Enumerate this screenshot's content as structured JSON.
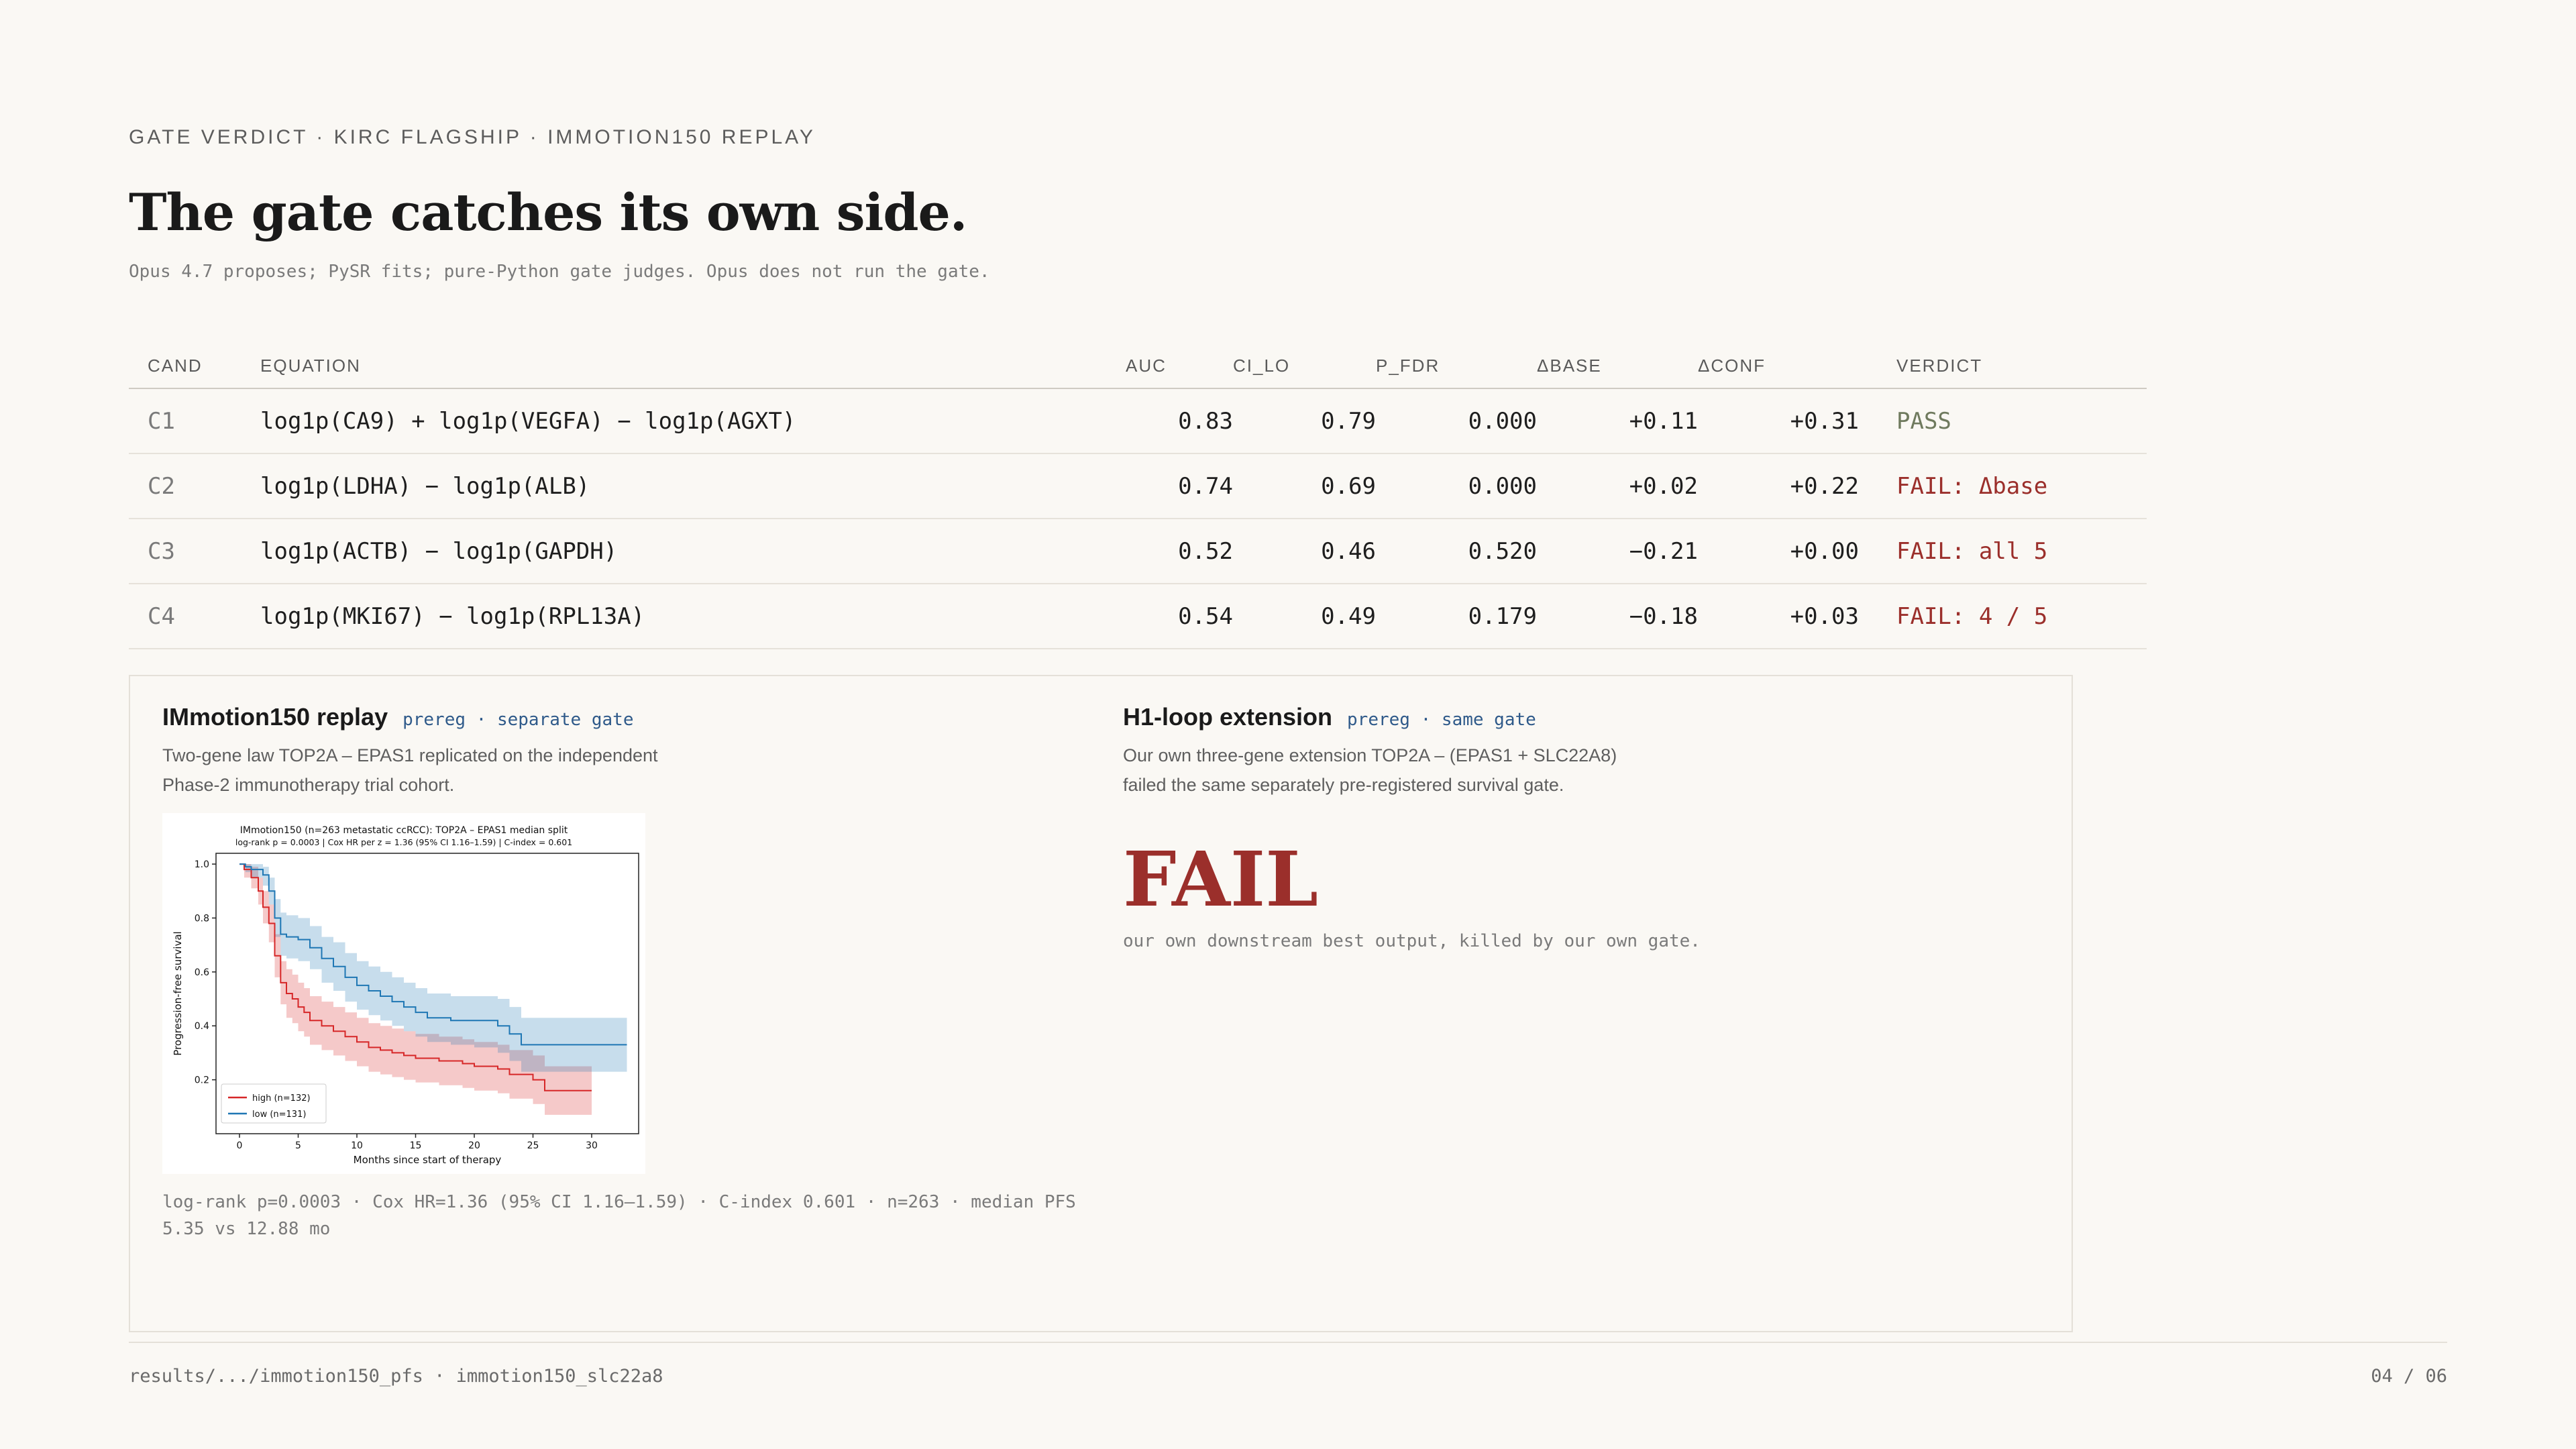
{
  "header": {
    "kicker": "GATE VERDICT · KIRC FLAGSHIP · IMMOTION150 REPLAY",
    "title": "The gate catches its own side.",
    "subtitle": "Opus 4.7 proposes; PySR fits; pure-Python gate judges. Opus does not run the gate."
  },
  "table": {
    "headers": [
      "CAND",
      "EQUATION",
      "AUC",
      "CI_LO",
      "P_FDR",
      "ΔBASE",
      "ΔCONF",
      "VERDICT"
    ],
    "rows": [
      {
        "cand": "C1",
        "equation": "log1p(CA9) + log1p(VEGFA) − log1p(AGXT)",
        "auc": "0.83",
        "ci_lo": "0.79",
        "p_fdr": "0.000",
        "dbase": "+0.11",
        "dconf": "+0.31",
        "verdict": "PASS",
        "status": "pass"
      },
      {
        "cand": "C2",
        "equation": "log1p(LDHA) − log1p(ALB)",
        "auc": "0.74",
        "ci_lo": "0.69",
        "p_fdr": "0.000",
        "dbase": "+0.02",
        "dconf": "+0.22",
        "verdict": "FAIL: Δbase",
        "status": "fail"
      },
      {
        "cand": "C3",
        "equation": "log1p(ACTB) − log1p(GAPDH)",
        "auc": "0.52",
        "ci_lo": "0.46",
        "p_fdr": "0.520",
        "dbase": "−0.21",
        "dconf": "+0.00",
        "verdict": "FAIL: all 5",
        "status": "fail"
      },
      {
        "cand": "C4",
        "equation": "log1p(MKI67) − log1p(RPL13A)",
        "auc": "0.54",
        "ci_lo": "0.49",
        "p_fdr": "0.179",
        "dbase": "−0.18",
        "dconf": "+0.03",
        "verdict": "FAIL: 4 / 5",
        "status": "fail"
      }
    ]
  },
  "replay": {
    "title": "IMmotion150 replay",
    "tag": "prereg · separate gate",
    "desc_line1": "Two-gene law TOP2A – EPAS1 replicated on the independent",
    "desc_line2": "Phase-2 immunotherapy trial cohort.",
    "stats_line1": "log-rank p=0.0003 · Cox HR=1.36 (95% CI 1.16–1.59) · C-index 0.601 · n=263 · median PFS",
    "stats_line2": "5.35 vs 12.88 mo"
  },
  "extension": {
    "title": "H1-loop extension",
    "tag": "prereg · same gate",
    "desc_line1": "Our own three-gene extension TOP2A – (EPAS1 + SLC22A8)",
    "desc_line2": "failed the same separately pre-registered survival gate.",
    "verdict": "FAIL",
    "note": "our own downstream best output, killed by our own gate."
  },
  "footer": {
    "path": "results/.../immotion150_pfs · immotion150_slc22a8",
    "page": "04 / 06"
  },
  "chart_data": {
    "type": "line",
    "title": "IMmotion150 (n=263 metastatic ccRCC): TOP2A – EPAS1 median split",
    "subtitle": "log-rank p = 0.0003  |  Cox HR per z = 1.36 (95% CI 1.16–1.59)  |  C-index = 0.601",
    "xlabel": "Months since start of therapy",
    "ylabel": "Progression-free survival",
    "xlim": [
      -2,
      34
    ],
    "ylim": [
      0,
      1.04
    ],
    "xticks": [
      "0",
      "5",
      "10",
      "15",
      "20",
      "25",
      "30"
    ],
    "yticks": [
      "0.2",
      "0.4",
      "0.6",
      "0.8",
      "1.0"
    ],
    "legend_position": "bottom-left",
    "series": [
      {
        "name": "high (n=132)",
        "color": "#d62728",
        "x": [
          0,
          0.4,
          1,
          1.6,
          2,
          2.5,
          3,
          3.5,
          4,
          4.5,
          5,
          5.5,
          6,
          7,
          8,
          9,
          10,
          11,
          12,
          13,
          14,
          15,
          17,
          19,
          20,
          22,
          23,
          25,
          26,
          30
        ],
        "y": [
          1.0,
          0.98,
          0.95,
          0.9,
          0.84,
          0.78,
          0.66,
          0.56,
          0.52,
          0.5,
          0.47,
          0.45,
          0.42,
          0.4,
          0.38,
          0.36,
          0.34,
          0.32,
          0.31,
          0.3,
          0.29,
          0.28,
          0.27,
          0.26,
          0.25,
          0.24,
          0.22,
          0.2,
          0.16,
          0.16
        ],
        "ci_lower": [
          1.0,
          0.95,
          0.91,
          0.85,
          0.78,
          0.71,
          0.58,
          0.48,
          0.43,
          0.41,
          0.38,
          0.36,
          0.33,
          0.31,
          0.29,
          0.27,
          0.25,
          0.23,
          0.22,
          0.21,
          0.2,
          0.19,
          0.18,
          0.17,
          0.16,
          0.15,
          0.13,
          0.11,
          0.07,
          0.07
        ],
        "ci_upper": [
          1.0,
          1.0,
          0.99,
          0.95,
          0.9,
          0.85,
          0.74,
          0.64,
          0.61,
          0.59,
          0.56,
          0.54,
          0.51,
          0.49,
          0.47,
          0.45,
          0.43,
          0.41,
          0.4,
          0.39,
          0.38,
          0.37,
          0.36,
          0.35,
          0.34,
          0.33,
          0.31,
          0.29,
          0.25,
          0.25
        ]
      },
      {
        "name": "low (n=131)",
        "color": "#1f77b4",
        "x": [
          0,
          0.5,
          1,
          2,
          2.5,
          3,
          3.5,
          4,
          5,
          6,
          7,
          8,
          9,
          10,
          11,
          12,
          13,
          14,
          15,
          16,
          18,
          20,
          22,
          23,
          24,
          33
        ],
        "y": [
          1.0,
          0.99,
          0.98,
          0.96,
          0.9,
          0.8,
          0.74,
          0.73,
          0.72,
          0.69,
          0.65,
          0.62,
          0.58,
          0.55,
          0.53,
          0.51,
          0.49,
          0.47,
          0.45,
          0.43,
          0.42,
          0.42,
          0.4,
          0.37,
          0.33,
          0.33
        ],
        "ci_lower": [
          1.0,
          0.97,
          0.95,
          0.92,
          0.85,
          0.73,
          0.66,
          0.65,
          0.64,
          0.61,
          0.56,
          0.53,
          0.49,
          0.46,
          0.44,
          0.42,
          0.4,
          0.38,
          0.36,
          0.34,
          0.33,
          0.32,
          0.3,
          0.27,
          0.23,
          0.23
        ],
        "ci_upper": [
          1.0,
          1.0,
          1.0,
          0.99,
          0.95,
          0.87,
          0.82,
          0.81,
          0.8,
          0.77,
          0.73,
          0.71,
          0.67,
          0.64,
          0.62,
          0.6,
          0.58,
          0.56,
          0.54,
          0.52,
          0.51,
          0.51,
          0.5,
          0.47,
          0.43,
          0.43
        ]
      }
    ]
  }
}
